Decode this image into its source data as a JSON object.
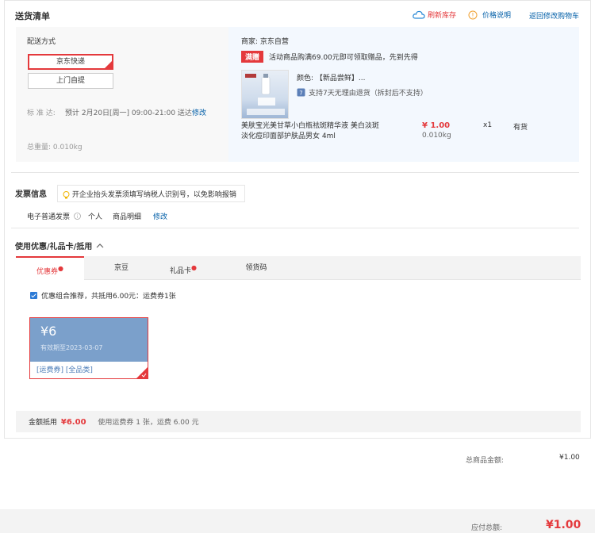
{
  "header": {
    "title": "送货清单",
    "refresh_label": "刷新库存",
    "price_label": "价格说明",
    "back_label": "返回修改购物车"
  },
  "shipping": {
    "method_label": "配送方式",
    "option_1": "京东快递",
    "option_2": "上门自提",
    "eta_prefix": "标  准  达:",
    "eta_text": "预计 2月20日[周一] 09:00-21:00 送达",
    "eta_edit": "修改",
    "weight_label": "总重量:",
    "weight_value": "0.010kg"
  },
  "merchant": {
    "label": "商家:",
    "name": "京东自营",
    "promo_badge": "满赠",
    "promo_text": "活动商品购满69.00元即可领取赠品，先到先得",
    "color_label": "颜色:",
    "color_value": "【新品尝鲜】...",
    "return_note": "支持7天无理由退货（拆封后不支持）",
    "product_name_1": "美肤宝光美甘草小白瓶祛斑精华液 美白淡斑",
    "product_name_2": "淡化痘印面部护肤品男女 4ml",
    "price": "¥ 1.00",
    "qty": "x1",
    "stock": "有货",
    "weight": "0.010kg"
  },
  "invoice": {
    "title": "发票信息",
    "tip": "开企业抬头发票须填写纳税人识别号，以免影响报销",
    "type": "电子普通发票",
    "person": "个人",
    "detail": "商品明细",
    "edit": "修改"
  },
  "discount": {
    "title": "使用优惠/礼品卡/抵用",
    "tabs": [
      "优惠券",
      "京豆",
      "礼品卡",
      "领货码"
    ],
    "recommend_text": "优惠组合推荐，共抵用6.00元：运费券1张",
    "coupon_amount": "¥6",
    "coupon_expiry": "有效期至2023-03-07",
    "coupon_tags": "[运费券]  [全品类]",
    "deduct_label": "金额抵用",
    "deduct_value": "¥6.00",
    "deduct_note": "使用运费券 1 张，运费 6.00 元"
  },
  "summary": {
    "goods_label": "总商品金额:",
    "goods_value": "¥1.00",
    "payable_label": "应付总额:",
    "payable_value": "¥1.00"
  },
  "colors": {
    "accent": "#e4393c",
    "link": "#005ea7",
    "coupon_bg": "#7ba0cb"
  }
}
